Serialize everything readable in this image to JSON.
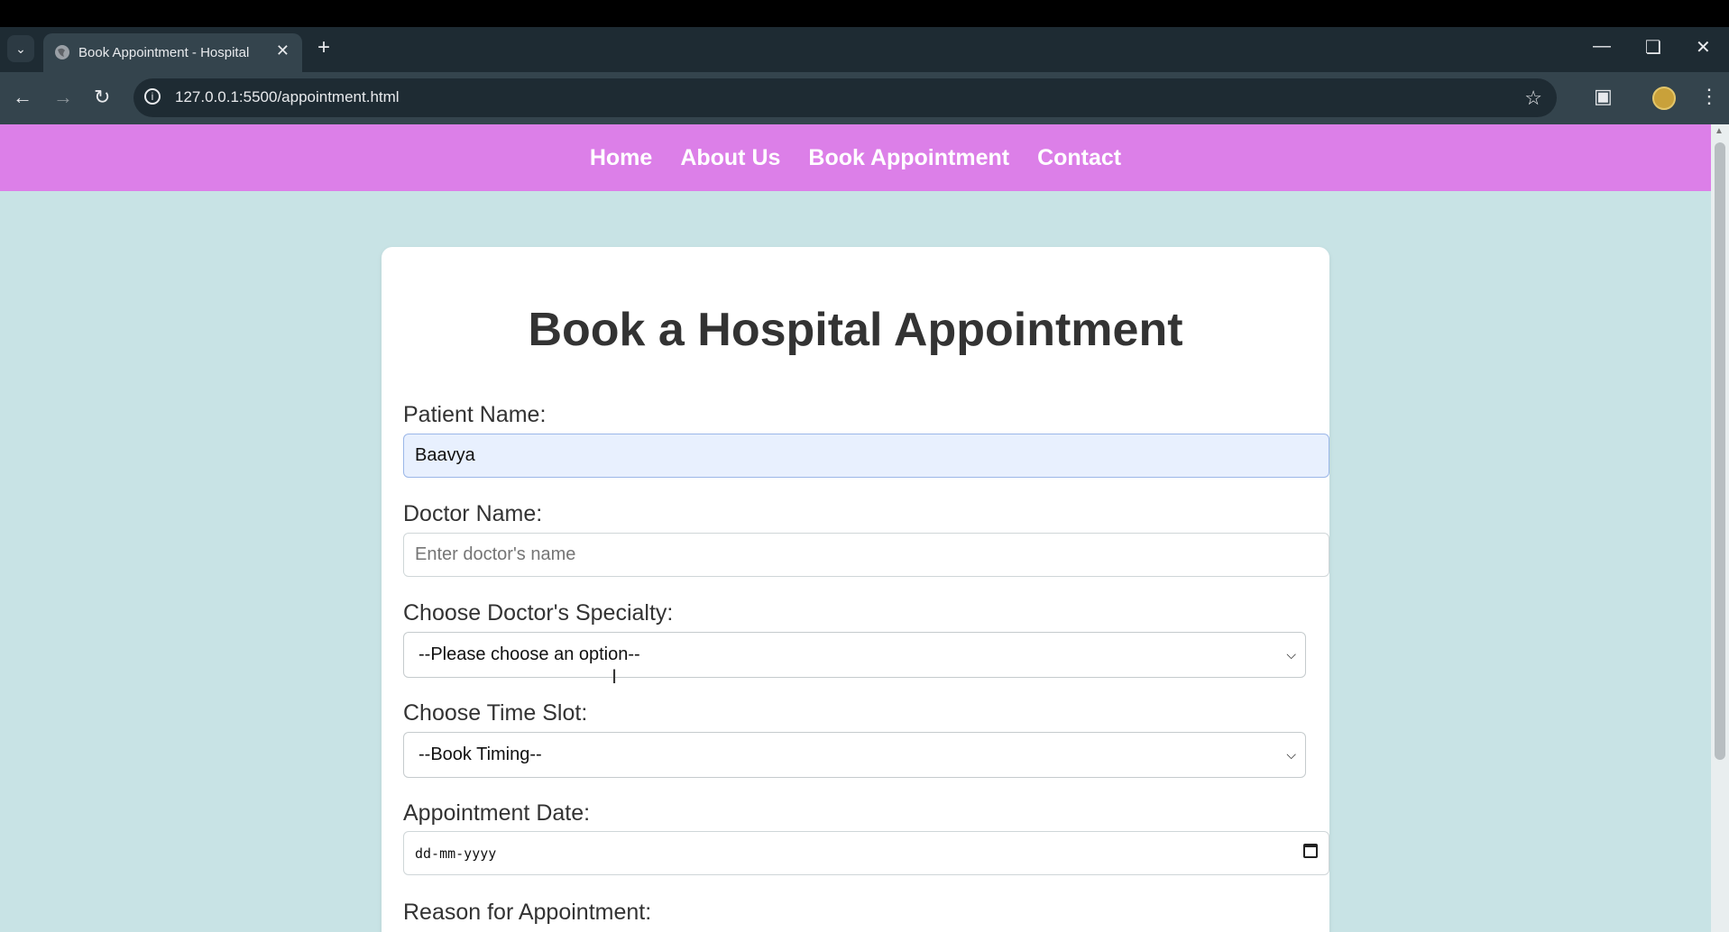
{
  "browser": {
    "tab_title": "Book Appointment - Hospital",
    "url": "127.0.0.1:5500/appointment.html",
    "icons": [
      "tab-dropdown-icon",
      "globe-icon",
      "close-icon",
      "plus-icon",
      "minimize-icon",
      "restore-icon",
      "window-close-icon",
      "back-icon",
      "forward-icon",
      "reload-icon",
      "info-icon",
      "star-icon",
      "extensions-icon",
      "profile-avatar",
      "menu-icon"
    ]
  },
  "nav": {
    "items": [
      "Home",
      "About Us",
      "Book Appointment",
      "Contact"
    ],
    "bg_color": "#dc7fe8"
  },
  "page_bg_color": "#c8e3e5",
  "form": {
    "title": "Book a Hospital Appointment",
    "patient_label": "Patient Name:",
    "patient_value": "Baavya",
    "doctor_label": "Doctor Name:",
    "doctor_placeholder": "Enter doctor's name",
    "specialty_label": "Choose Doctor's Specialty:",
    "specialty_value": "--Please choose an option--",
    "time_label": "Choose Time Slot:",
    "time_value": "--Book Timing--",
    "date_label": "Appointment Date:",
    "date_placeholder": "dd-mm-yyyy",
    "reason_label": "Reason for Appointment:"
  }
}
